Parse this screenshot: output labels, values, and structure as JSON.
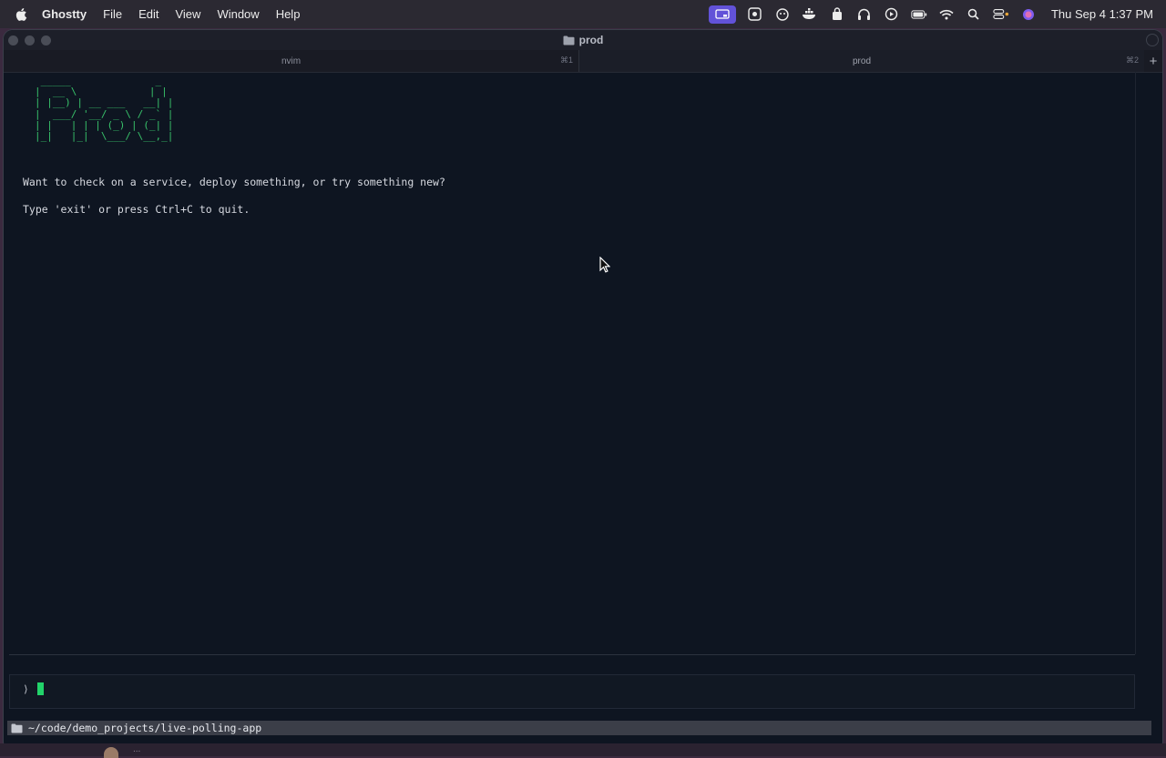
{
  "menubar": {
    "app_name": "Ghostty",
    "menus": [
      "File",
      "Edit",
      "View",
      "Window",
      "Help"
    ],
    "status_icons": [
      "screen-share-icon",
      "app-icon",
      "cat-icon",
      "docker-icon",
      "bag-icon",
      "headphones-icon",
      "play-icon",
      "battery-icon",
      "wifi-icon",
      "search-icon",
      "control-center-icon",
      "siri-icon"
    ],
    "clock": "Thu Sep 4  1:37 PM",
    "accent_color": "#6252d8"
  },
  "window": {
    "title": "prod",
    "tabs": [
      {
        "label": "nvim",
        "shortcut": "⌘1"
      },
      {
        "label": "prod",
        "shortcut": "⌘2"
      }
    ],
    "new_tab_label": "+"
  },
  "terminal": {
    "ascii_art": " _____              _\n|  __ \\            | |\n| |__) | __ ___   __| |\n|  ___/ '__/ _ \\ / _` |\n| |   | | | (_) | (_| |\n|_|   |_|  \\___/ \\__,_|",
    "ascii_color": "#38c26a",
    "lines": [
      "Want to check on a service, deploy something, or try something new?",
      "Type 'exit' or press Ctrl+C to quit."
    ],
    "prompt": "⟩",
    "cursor_color": "#22d36a"
  },
  "statusbar": {
    "path": "~/code/demo_projects/live-polling-app"
  },
  "dock": {
    "ellipsis": "..."
  }
}
